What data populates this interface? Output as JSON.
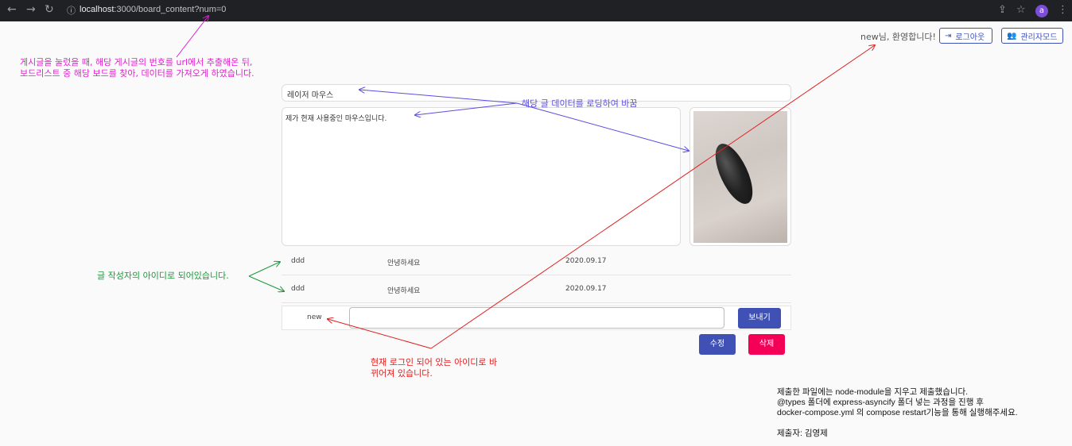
{
  "browser": {
    "url_host": "localhost",
    "url_rest": ":3000/board_content?num=0",
    "avatar_letter": "a"
  },
  "header": {
    "welcome": "new님, 환영합니다!",
    "logout_label": "로그아웃",
    "admin_label": "관리자모드"
  },
  "post": {
    "title": "레이저 마우스",
    "content": "제가 현재 사용중인 마우스입니다."
  },
  "comments": [
    {
      "user": "ddd",
      "text": "안녕하세요",
      "date": "2020.09.17"
    },
    {
      "user": "ddd",
      "text": "안녕하세요",
      "date": "2020.09.17"
    }
  ],
  "reply": {
    "user": "new",
    "value": "",
    "send_label": "보내기"
  },
  "actions": {
    "edit_label": "수정",
    "delete_label": "삭제"
  },
  "annotations": {
    "magenta_line1": "게시글을 눌렀을 때, 해당 게시글의 번호를 url에서 추출해온 뒤,",
    "magenta_line2": "보드리스트 중 해당 보드를 찾아, 데이터를 가져오게 하였습니다.",
    "blue": "해당 글 데이터를 로딩하여 바꿈",
    "green": "글 작성자의 아이디로 되어있습니다.",
    "red_line1": "현재 로그인 되어 있는 아이디로 바",
    "red_line2": "뀌어져 있습니다."
  },
  "submission_note": {
    "line1": "제출한 파일에는 node-module을 지우고 제출했습니다.",
    "line2": "@types 폴더에 express-asyncify 폴더 넣는 과정을 진행 후",
    "line3": "docker-compose.yml 의 compose restart기능을 통해 실행해주세요.",
    "line4": "제출자: 김영제"
  },
  "colors": {
    "primary": "#3f51b5",
    "danger": "#f50057",
    "annotation_magenta": "#e020d0",
    "annotation_blue": "#5b4ee0",
    "annotation_green": "#1a9a3a",
    "annotation_red": "#e02020"
  }
}
